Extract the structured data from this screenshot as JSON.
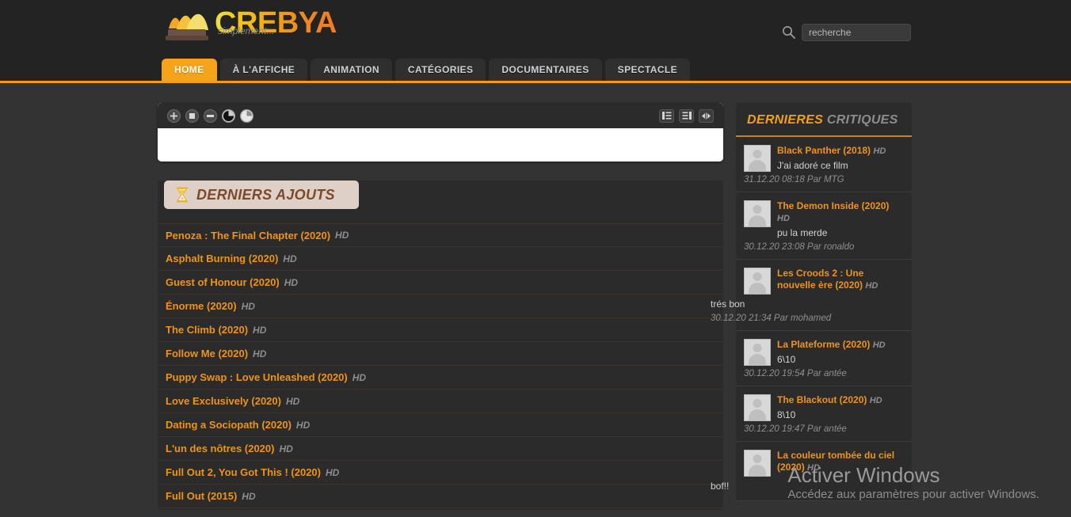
{
  "site": {
    "logo_title": "CREBYA",
    "logo_tagline": "simplement...",
    "logo_icon": "opera-house-book-icon"
  },
  "search": {
    "icon": "search-icon",
    "placeholder": "recherche",
    "value": ""
  },
  "nav": {
    "items": [
      {
        "label": "HOME",
        "active": true
      },
      {
        "label": "À L'AFFICHE",
        "active": false
      },
      {
        "label": "ANIMATION",
        "active": false
      },
      {
        "label": "CATÉGORIES",
        "active": false
      },
      {
        "label": "DOCUMENTAIRES",
        "active": false
      },
      {
        "label": "SPECTACLE",
        "active": false
      }
    ]
  },
  "player": {
    "left_controls": [
      {
        "icon": "zoom-in-icon"
      },
      {
        "icon": "stop-square-icon"
      },
      {
        "icon": "zoom-out-icon"
      },
      {
        "icon": "contrast-dark-pie-icon"
      },
      {
        "icon": "contrast-light-pie-icon"
      }
    ],
    "right_controls": [
      {
        "icon": "layout-list-left-icon"
      },
      {
        "icon": "layout-list-right-icon"
      },
      {
        "icon": "expand-horizontal-icon"
      }
    ]
  },
  "latest": {
    "icon": "hourglass-icon",
    "title": "DERNIERS AJOUTS",
    "items": [
      {
        "title": "Penoza : The Final Chapter (2020)",
        "quality": "HD"
      },
      {
        "title": "Asphalt Burning (2020)",
        "quality": "HD"
      },
      {
        "title": "Guest of Honour (2020)",
        "quality": "HD"
      },
      {
        "title": "Énorme (2020)",
        "quality": "HD"
      },
      {
        "title": "The Climb (2020)",
        "quality": "HD"
      },
      {
        "title": "Follow Me (2020)",
        "quality": "HD"
      },
      {
        "title": "Puppy Swap : Love Unleashed (2020)",
        "quality": "HD"
      },
      {
        "title": "Love Exclusively (2020)",
        "quality": "HD"
      },
      {
        "title": "Dating a Sociopath (2020)",
        "quality": "HD"
      },
      {
        "title": "L'un des nôtres (2020)",
        "quality": "HD"
      },
      {
        "title": "Full Out 2, You Got This ! (2020)",
        "quality": "HD"
      },
      {
        "title": "Full Out (2015)",
        "quality": "HD"
      }
    ]
  },
  "reviews": {
    "title_word1": "DERNIERES",
    "title_word2": "CRITIQUES",
    "items": [
      {
        "movie": "Black Panther (2018)",
        "quality": "HD",
        "comment": "J'ai adoré ce film",
        "meta": "31.12.20 08:18 Par MTG",
        "avatar": "user-avatar"
      },
      {
        "movie": "The Demon Inside (2020)",
        "quality": "HD",
        "comment": "pu la merde",
        "meta": "30.12.20 23:08 Par ronaldo",
        "avatar": "user-avatar"
      },
      {
        "movie": "Les Croods 2 : Une nouvelle ère (2020)",
        "quality": "HD",
        "comment": "trés bon",
        "meta": "30.12.20 21:34 Par mohamed",
        "avatar": "user-avatar",
        "wide": true
      },
      {
        "movie": "La Plateforme (2020)",
        "quality": "HD",
        "comment": "6\\10",
        "meta": "30.12.20 19:54 Par antée",
        "avatar": "user-avatar"
      },
      {
        "movie": "The Blackout (2020)",
        "quality": "HD",
        "comment": "8\\10",
        "meta": "30.12.20 19:47 Par antée",
        "avatar": "user-avatar"
      },
      {
        "movie": "La couleur tombée du ciel (2020)",
        "quality": "HD",
        "comment": "bof!!",
        "meta": "",
        "avatar": "user-avatar",
        "wide": true
      }
    ]
  },
  "watermark": {
    "line1": "Activer Windows",
    "line2": "Accédez aux paramètres pour activer Windows."
  },
  "colors": {
    "accent": "#f39c12",
    "link": "#f0931a",
    "header_bg": "#232323",
    "body_bg": "#333333",
    "panel_bg": "#2b2b2b",
    "panel_head_bg": "#ded0c7",
    "panel_head_text": "#7a4a2a"
  }
}
